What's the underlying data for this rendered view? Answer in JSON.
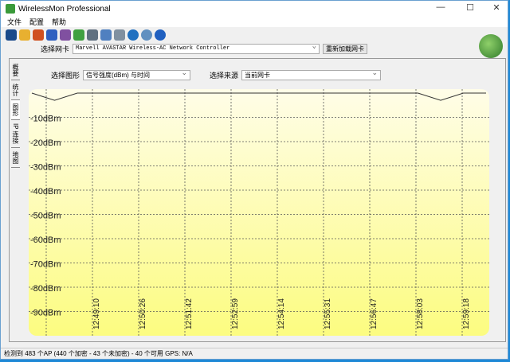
{
  "window": {
    "title": "WirelessMon Professional",
    "minimize": "—",
    "maximize": "☐",
    "close": "✕"
  },
  "menu": [
    "文件",
    "配置",
    "帮助"
  ],
  "toolbar_icons": [
    "save-icon",
    "open-icon",
    "record-icon",
    "network-icon",
    "network2-icon",
    "export-icon",
    "print-icon",
    "printer-icon",
    "clipboard-icon",
    "refresh-icon",
    "info-icon",
    "help-icon"
  ],
  "adapter": {
    "label": "选择网卡",
    "value": "Marvell AVASTAR Wireless-AC Network Controller",
    "reload": "重新加载网卡"
  },
  "tabs": [
    "概要",
    "统计",
    "图形",
    "IP 连接",
    "地图"
  ],
  "graph": {
    "type_label": "选择图形",
    "type_value": "信号强度(dBm) 与时间",
    "source_label": "选择来源",
    "source_value": "当前网卡"
  },
  "chart_data": {
    "type": "line",
    "ylabel": "dBm",
    "ylim": [
      -100,
      0
    ],
    "yticks": [
      "-10dBm",
      "-20dBm",
      "-30dBm",
      "-40dBm",
      "-50dBm",
      "-60dBm",
      "-70dBm",
      "-80dBm",
      "-90dBm"
    ],
    "xticks": [
      "12:49:10",
      "12:50:26",
      "12:51:42",
      "12:52:59",
      "12:54:14",
      "12:55:31",
      "12:56:47",
      "12:58:03",
      "12:59:18"
    ],
    "series": [
      {
        "name": "信号强度",
        "values": [
          0,
          -1,
          0,
          0,
          0,
          0,
          0,
          0,
          0,
          0,
          0,
          0,
          0,
          0,
          0,
          0,
          0,
          0,
          -1,
          0,
          0
        ]
      }
    ]
  },
  "status": "检测到 483 个AP (440 个加密 - 43 个未加密) - 40 个可用 GPS: N/A"
}
